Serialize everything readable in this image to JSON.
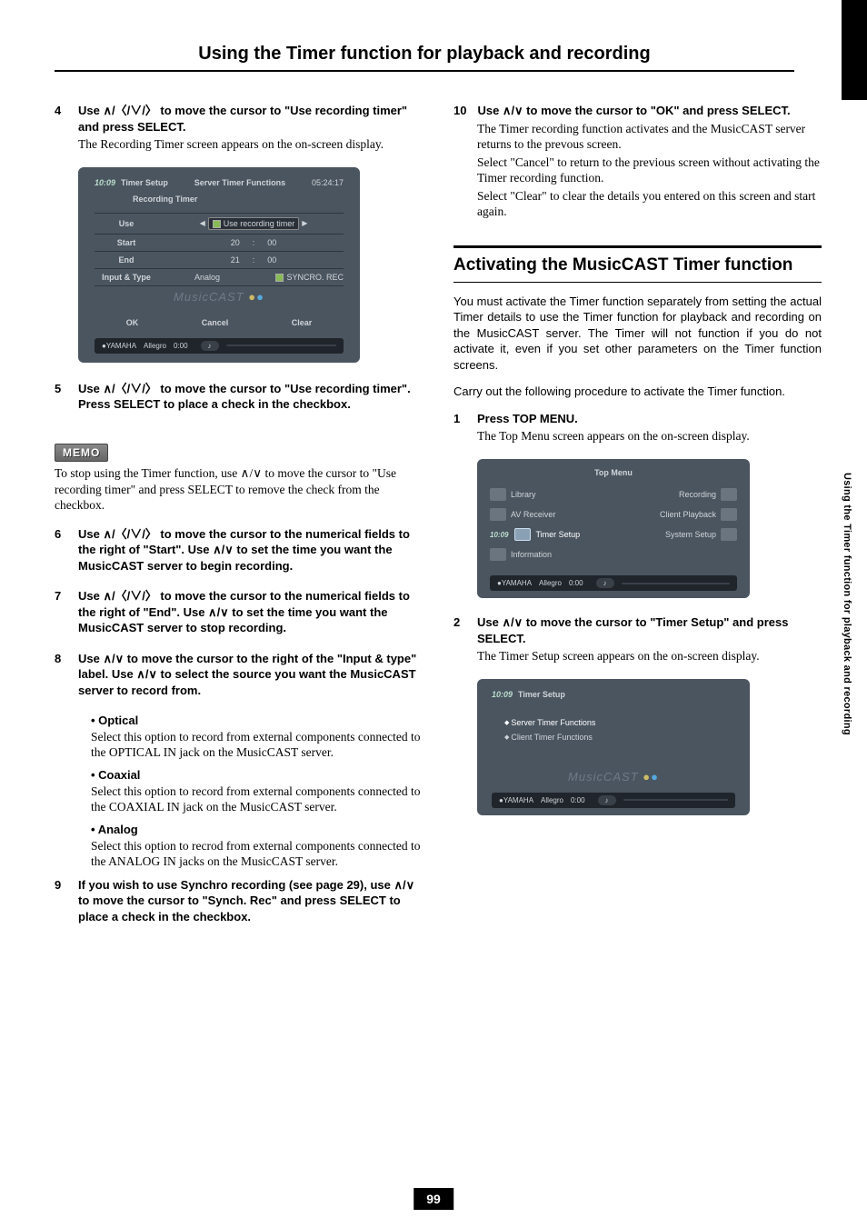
{
  "page_title": "Using the Timer function for playback and recording",
  "side_label": "Using the Timer function for playback and recording",
  "page_number": "99",
  "memo_label": "MEMO",
  "memo_text": "To stop using the Timer function, use ∧/∨ to move the cursor to \"Use recording timer\" and press SELECT to remove the check from the checkbox.",
  "left": {
    "step4": {
      "num": "4",
      "head": "Use ∧/〈/∨/〉 to move the cursor to \"Use recording timer\" and press SELECT.",
      "body": "The Recording Timer screen appears on the on-screen display."
    },
    "step5": {
      "num": "5",
      "head": "Use ∧/〈/∨/〉 to move the cursor to \"Use recording timer\". Press SELECT to place a check in the checkbox."
    },
    "step6": {
      "num": "6",
      "head": "Use ∧/〈/∨/〉 to move the cursor to the numerical fields to the right of \"Start\". Use ∧/∨ to set the time you want the MusicCAST server to begin recording."
    },
    "step7": {
      "num": "7",
      "head": "Use ∧/〈/∨/〉 to move the cursor to the numerical fields to the right of \"End\". Use ∧/∨ to set the time you want the MusicCAST server to stop recording."
    },
    "step8": {
      "num": "8",
      "head": "Use ∧/∨ to move the cursor to the right of the \"Input & type\" label. Use ∧/∨ to select the source you want the MusicCAST server to record from.",
      "optical": {
        "head": "Optical",
        "body": "Select this option to record from external components connected to the OPTICAL IN jack on the MusicCAST server."
      },
      "coaxial": {
        "head": "Coaxial",
        "body": "Select this option to record from external components connected to the COAXIAL IN jack on the MusicCAST server."
      },
      "analog": {
        "head": "Analog",
        "body": "Select this option to recrod from external components connected to the ANALOG IN jacks on the MusicCAST server."
      }
    },
    "step9": {
      "num": "9",
      "head": "If you wish to use Synchro recording (see page 29), use ∧/∨ to move the cursor to \"Synch. Rec\" and press SELECT to place a check in the checkbox."
    },
    "scr1": {
      "clock": "10:09",
      "breadcrumb": "Timer Setup",
      "title1": "Server Timer Functions",
      "title2": "Recording Timer",
      "time_right": "05:24:17",
      "rows": {
        "use": "Use",
        "use_field": "Use recording timer",
        "start": "Start",
        "start_h": "20",
        "start_m": "00",
        "end": "End",
        "end_h": "21",
        "end_m": "00",
        "input": "Input & Type",
        "input_val": "Analog",
        "sync": "SYNCRO. REC"
      },
      "wm": "MusicCAST",
      "ok": "OK",
      "cancel": "Cancel",
      "clear": "Clear",
      "brand": "YAMAHA",
      "track": "Allegro",
      "pos": "0:00"
    }
  },
  "right": {
    "step10": {
      "num": "10",
      "head": "Use ∧/∨ to move the cursor to \"OK\" and press SELECT.",
      "body1": "The Timer recording function activates and the MusicCAST server returns to the prevous screen.",
      "body2": "Select \"Cancel\" to return to the previous screen without activating the Timer recording function.",
      "body3": "Select \"Clear\" to clear the details you entered on this screen and start again."
    },
    "section_heading": "Activating the MusicCAST Timer function",
    "section_p1": "You must activate the Timer function separately from setting the actual Timer details to use the Timer function for playback and recording on the MusicCAST server. The Timer will not function if you do not activate it, even if you set other parameters on the Timer function screens.",
    "section_p2": "Carry out the following procedure to activate the Timer function.",
    "step1": {
      "num": "1",
      "head": "Press TOP MENU.",
      "body": "The Top Menu screen appears on the on-screen display."
    },
    "step2": {
      "num": "2",
      "head": "Use ∧/∨ to move the cursor to \"Timer Setup\" and press SELECT.",
      "body": "The Timer Setup screen appears on the on-screen display."
    },
    "topmenu": {
      "title": "Top Menu",
      "items_l": [
        "Library",
        "AV Receiver",
        "Timer Setup",
        "Information"
      ],
      "items_r": [
        "Recording",
        "Client Playback",
        "System Setup"
      ],
      "clock": "10:09",
      "brand": "YAMAHA",
      "track": "Allegro",
      "pos": "0:00"
    },
    "tsetup": {
      "clock": "10:09",
      "breadcrumb": "Timer Setup",
      "item1": "Server Timer Functions",
      "item2": "Client Timer Functions",
      "wm": "MusicCAST",
      "brand": "YAMAHA",
      "track": "Allegro",
      "pos": "0:00"
    }
  }
}
